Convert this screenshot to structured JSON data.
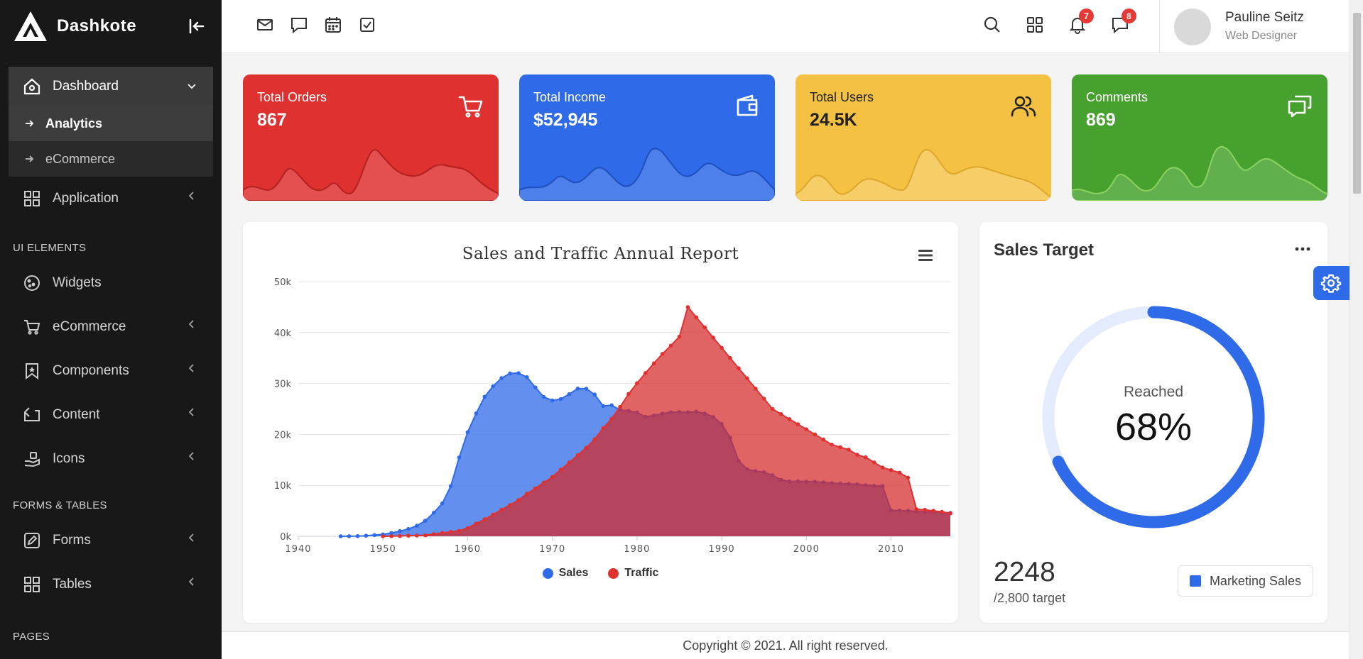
{
  "brand": {
    "name": "Dashkote"
  },
  "sidebar": {
    "dashboard": {
      "label": "Dashboard",
      "subitems": [
        {
          "label": "Analytics"
        },
        {
          "label": "eCommerce"
        }
      ]
    },
    "items_main": [
      {
        "label": "Application",
        "icon": "grid-icon"
      }
    ],
    "section_ui": "UI ELEMENTS",
    "items_ui": [
      {
        "label": "Widgets",
        "icon": "cookie-icon"
      },
      {
        "label": "eCommerce",
        "icon": "cart-icon"
      },
      {
        "label": "Components",
        "icon": "bookmark-icon"
      },
      {
        "label": "Content",
        "icon": "repeat-icon"
      },
      {
        "label": "Icons",
        "icon": "hand-icon"
      }
    ],
    "section_forms": "FORMS & TABLES",
    "items_forms": [
      {
        "label": "Forms",
        "icon": "pen-square-icon"
      },
      {
        "label": "Tables",
        "icon": "grid-icon"
      }
    ],
    "section_pages": "PAGES"
  },
  "topbar": {
    "notifications_count": "7",
    "messages_count": "8",
    "user": {
      "name": "Pauline Seitz",
      "role": "Web Designer"
    }
  },
  "stats": [
    {
      "label": "Total Orders",
      "value": "867",
      "color": "#e03131",
      "icon": "cart-icon"
    },
    {
      "label": "Total Income",
      "value": "$52,945",
      "color": "#2f6ae8",
      "icon": "wallet-icon"
    },
    {
      "label": "Total Users",
      "value": "24.5K",
      "color": "#f4c142",
      "icon": "users-icon"
    },
    {
      "label": "Comments",
      "value": "869",
      "color": "#47a12f",
      "icon": "comments-icon"
    }
  ],
  "chart_data": {
    "type": "area",
    "title": "Sales and Traffic Annual Report",
    "xlim": [
      1940,
      2017
    ],
    "ylim": [
      0,
      50000
    ],
    "yticks": [
      "0k",
      "10k",
      "20k",
      "30k",
      "40k",
      "50k"
    ],
    "xticks": [
      "1940",
      "1950",
      "1960",
      "1970",
      "1980",
      "1990",
      "2000",
      "2010"
    ],
    "grid": true,
    "legend_position": "bottom",
    "series": [
      {
        "name": "Sales",
        "color": "#2f6ae8",
        "x": [
          1945,
          1946,
          1947,
          1948,
          1949,
          1950,
          1951,
          1952,
          1953,
          1954,
          1955,
          1956,
          1957,
          1958,
          1959,
          1960,
          1961,
          1962,
          1963,
          1964,
          1965,
          1966,
          1967,
          1968,
          1969,
          1970,
          1971,
          1972,
          1973,
          1974,
          1975,
          1976,
          1977,
          1978,
          1979,
          1980,
          1981,
          1982,
          1983,
          1984,
          1985,
          1986,
          1987,
          1988,
          1989,
          1990,
          1991,
          1992,
          1993,
          1994,
          1995,
          1996,
          1997,
          1998,
          1999,
          2000,
          2001,
          2002,
          2003,
          2004,
          2005,
          2006,
          2007,
          2008,
          2009,
          2010,
          2011,
          2012,
          2013,
          2014,
          2015,
          2016,
          2017
        ],
        "y": [
          6,
          11,
          32,
          110,
          235,
          369,
          640,
          1005,
          1436,
          2063,
          3057,
          4618,
          6444,
          9822,
          15468,
          20434,
          24126,
          27387,
          29459,
          31056,
          31982,
          32040,
          31233,
          29224,
          27342,
          26662,
          26956,
          27912,
          28999,
          28965,
          27826,
          25579,
          25722,
          24826,
          24605,
          24304,
          23464,
          23708,
          24099,
          24357,
          24401,
          24344,
          24482,
          24094,
          23430,
          22035,
          19360,
          14812,
          13181,
          12794,
          12577,
          11981,
          11088,
          10777,
          10778,
          10736,
          10716,
          10584,
          10431,
          10351,
          10304,
          10211,
          10048,
          9917,
          9869,
          5100,
          5052,
          5000,
          4890,
          4810,
          4788,
          4700,
          4600
        ]
      },
      {
        "name": "Traffic",
        "color": "#e03131",
        "x": [
          1950,
          1951,
          1952,
          1953,
          1954,
          1955,
          1956,
          1957,
          1958,
          1959,
          1960,
          1961,
          1962,
          1963,
          1964,
          1965,
          1966,
          1967,
          1968,
          1969,
          1970,
          1971,
          1972,
          1973,
          1974,
          1975,
          1976,
          1977,
          1978,
          1979,
          1980,
          1981,
          1982,
          1983,
          1984,
          1985,
          1986,
          1987,
          1988,
          1989,
          1990,
          1991,
          1992,
          1993,
          1994,
          1995,
          1996,
          1997,
          1998,
          1999,
          2000,
          2001,
          2002,
          2003,
          2004,
          2005,
          2006,
          2007,
          2008,
          2009,
          2010,
          2011,
          2012,
          2013,
          2014,
          2015,
          2016,
          2017
        ],
        "y": [
          5,
          25,
          50,
          120,
          150,
          200,
          426,
          660,
          869,
          1060,
          1605,
          2471,
          3322,
          4238,
          5221,
          6129,
          7089,
          8339,
          9399,
          10538,
          11643,
          13092,
          14478,
          15915,
          17385,
          19055,
          21205,
          23044,
          25393,
          27935,
          30062,
          32049,
          33952,
          35804,
          37431,
          39197,
          45000,
          43000,
          41000,
          39000,
          37000,
          35000,
          33000,
          31000,
          29000,
          27000,
          25000,
          24000,
          23000,
          22000,
          21000,
          20000,
          19000,
          18000,
          17500,
          17000,
          16000,
          15500,
          14500,
          13500,
          13000,
          12500,
          11500,
          5300,
          5200,
          5000,
          4800,
          4500
        ]
      }
    ]
  },
  "sales_target": {
    "title": "Sales Target",
    "reached_label": "Reached",
    "percent_text": "68%",
    "percent": 0.68,
    "amount": "2248",
    "target_text": "/2,800 target",
    "legend_label": "Marketing Sales",
    "ring_color": "#2f6ae8",
    "track_color": "#e3ebfc"
  },
  "footer": {
    "copyright": "Copyright © 2021. All right reserved."
  }
}
